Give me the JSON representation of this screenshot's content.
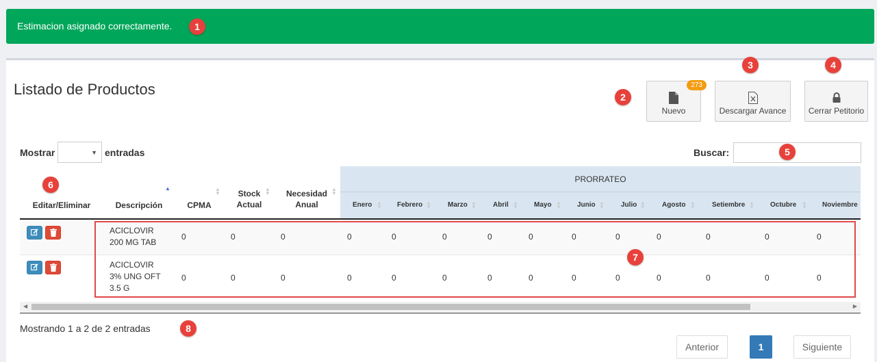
{
  "alert": {
    "message": "Estimacion asignado correctamente."
  },
  "page": {
    "title": "Listado de Productos"
  },
  "toolbar": {
    "nuevo_label": "Nuevo",
    "nuevo_badge": "273",
    "descargar_label": "Descargar Avance",
    "cerrar_label": "Cerrar Petitorio"
  },
  "controls": {
    "show_label": "Mostrar",
    "entries_label": "entradas",
    "length_value": "",
    "search_label": "Buscar:",
    "search_value": ""
  },
  "table": {
    "headers": {
      "edit": "Editar/Eliminar",
      "desc": "Descripción",
      "cpma": "CPMA",
      "stock": "Stock Actual",
      "necesidad": "Necesidad Anual",
      "prorrateo": "PRORRATEO"
    },
    "months": [
      "Enero",
      "Febrero",
      "Marzo",
      "Abril",
      "Mayo",
      "Junio",
      "Julio",
      "Agosto",
      "Setiembre",
      "Octubre",
      "Noviembre"
    ],
    "rows": [
      {
        "desc_lines": [
          "ACICLOVIR",
          "200 MG TAB"
        ],
        "cpma": "0",
        "stock": "0",
        "necesidad": "0",
        "months": [
          "0",
          "0",
          "0",
          "0",
          "0",
          "0",
          "0",
          "0",
          "0",
          "0"
        ]
      },
      {
        "desc_lines": [
          "ACICLOVIR",
          "3% UNG OFT",
          "3.5 G"
        ],
        "cpma": "0",
        "stock": "0",
        "necesidad": "0",
        "months": [
          "0",
          "0",
          "0",
          "0",
          "0",
          "0",
          "0",
          "0",
          "0",
          "0"
        ]
      }
    ]
  },
  "footer": {
    "info": "Mostrando 1 a 2 de 2 entradas",
    "prev": "Anterior",
    "page": "1",
    "next": "Siguiente"
  },
  "markers": [
    "1",
    "2",
    "3",
    "4",
    "5",
    "6",
    "7",
    "8"
  ],
  "colors": {
    "success": "#00a65a",
    "primary": "#3c8dbc",
    "danger": "#dd4b39",
    "marker": "#e8413b",
    "badge": "#f39c12"
  }
}
